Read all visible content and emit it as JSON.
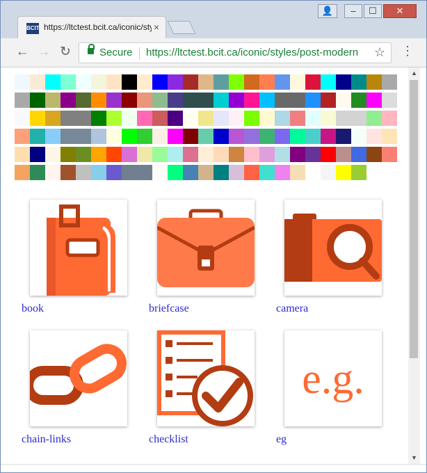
{
  "browser": {
    "tab_title": "https://ltctest.bcit.ca/iconic/styles",
    "tab_favicon_text": "BCIT",
    "security_label": "Secure",
    "url_scheme_host": "https://ltctest.bcit.ca",
    "url_path": "/iconic/styles/post-modern",
    "nav": {
      "back": "←",
      "forward": "→",
      "reload": "↻"
    },
    "star_icon": "star-icon",
    "menu_icon": "⋮",
    "window_buttons": {
      "profile": "👤",
      "minimize": "–",
      "maximize": "☐",
      "close": "✕"
    }
  },
  "palette": [
    [
      "#f0f8ff",
      "#faebd7",
      "#00ffff",
      "#7fffd4",
      "#f0ffff",
      "#f5f5dc",
      "#ffe4c4",
      "#000000",
      "#ffebcd",
      "#0000ff",
      "#8a2be2",
      "#a52a2a",
      "#deb887",
      "#5f9ea0",
      "#7fff00",
      "#d2691e",
      "#ff7f50",
      "#6495ed",
      "#fff8dc",
      "#dc143c",
      "#00ffff",
      "#00008b",
      "#008b8b",
      "#b8860b",
      "#a9a9a9"
    ],
    [
      "#a9a9a9",
      "#006400",
      "#bdb76b",
      "#8b008b",
      "#556b2f",
      "#ff8c00",
      "#9932cc",
      "#8b0000",
      "#e9967a",
      "#8fbc8f",
      "#483d8b",
      "#2f4f4f",
      "#2f4f4f",
      "#00ced1",
      "#9400d3",
      "#ff1493",
      "#00bfff",
      "#696969",
      "#696969",
      "#1e90ff",
      "#b22222",
      "#fffaf0",
      "#228b22",
      "#ff00ff",
      "#dcdcdc"
    ],
    [
      "#f8f8ff",
      "#ffd700",
      "#daa520",
      "#808080",
      "#808080",
      "#008000",
      "#adff2f",
      "#f0fff0",
      "#ff69b4",
      "#cd5c5c",
      "#4b0082",
      "#fffff0",
      "#f0e68c",
      "#e6e6fa",
      "#fff0f5",
      "#7cfc00",
      "#fffacd",
      "#add8e6",
      "#f08080",
      "#e0ffff",
      "#fafad2",
      "#d3d3d3",
      "#d3d3d3",
      "#90ee90",
      "#ffb6c1"
    ],
    [
      "#ffa07a",
      "#20b2aa",
      "#87cefa",
      "#778899",
      "#778899",
      "#b0c4de",
      "#ffffe0",
      "#00ff00",
      "#32cd32",
      "#faf0e6",
      "#ff00ff",
      "#800000",
      "#66cdaa",
      "#0000cd",
      "#ba55d3",
      "#9370db",
      "#3cb371",
      "#7b68ee",
      "#00fa9a",
      "#48d1cc",
      "#c71585",
      "#191970",
      "#f5fffa",
      "#ffe4e1",
      "#ffe4b5"
    ],
    [
      "#ffdead",
      "#000080",
      "#fdf5e6",
      "#808000",
      "#6b8e23",
      "#ffa500",
      "#ff4500",
      "#da70d6",
      "#eee8aa",
      "#98fb98",
      "#afeeee",
      "#db7093",
      "#ffefd5",
      "#ffdab9",
      "#cd853f",
      "#ffc0cb",
      "#dda0dd",
      "#b0e0e6",
      "#800080",
      "#663399",
      "#ff0000",
      "#bc8f8f",
      "#4169e1",
      "#8b4513",
      "#fa8072"
    ],
    [
      "#f4a460",
      "#2e8b57",
      "#fff5ee",
      "#a0522d",
      "#c0c0c0",
      "#87ceeb",
      "#6a5acd",
      "#708090",
      "#708090",
      "#fffafa",
      "#00ff7f",
      "#4682b4",
      "#d2b48c",
      "#008080",
      "#d8bfd8",
      "#ff6347",
      "#40e0d0",
      "#ee82ee",
      "#f5deb3",
      "#ffffff",
      "#f5f5f5",
      "#ffff00",
      "#9acd32"
    ]
  ],
  "icons": [
    {
      "name": "book",
      "label": "book",
      "color": "#ff6a33"
    },
    {
      "name": "briefcase",
      "label": "briefcase",
      "color": "#ff6a33"
    },
    {
      "name": "camera",
      "label": "camera",
      "color": "#ff6a33"
    },
    {
      "name": "chain-links",
      "label": "chain-links",
      "color": "#ff6a33"
    },
    {
      "name": "checklist",
      "label": "checklist",
      "color": "#ff6a33"
    },
    {
      "name": "eg",
      "label": "eg",
      "color": "#ff6a33",
      "glyph": "e.g."
    }
  ],
  "colors": {
    "accent": "#ff6a33",
    "dark_accent": "#a8320c",
    "link": "#2b2bd0"
  }
}
